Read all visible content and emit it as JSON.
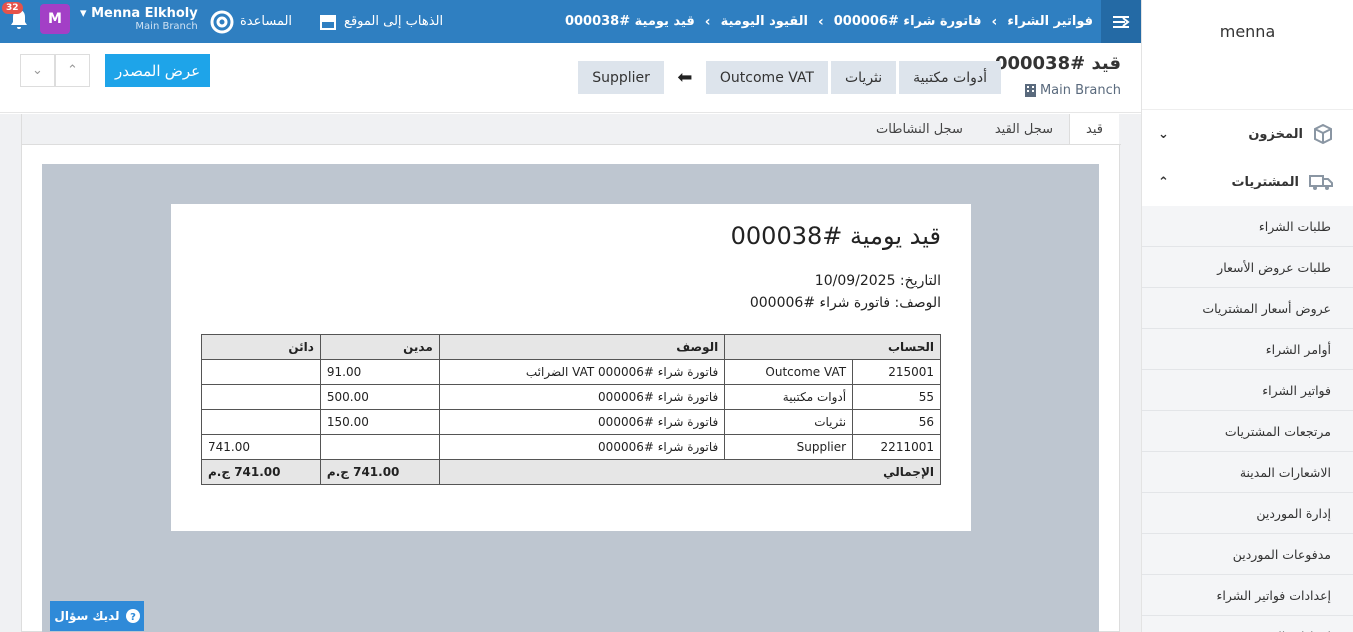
{
  "topbar": {
    "breadcrumbs": [
      "فواتير الشراء",
      "فاتورة شراء #000006",
      "القيود اليومية",
      "قيد يومية #000038"
    ],
    "goto_site": "الذهاب إلى الموقع",
    "help": "المساعدة",
    "notifications_count": "32",
    "user_name": "Menna Elkholy",
    "user_branch": "Main Branch",
    "avatar_letter": "M"
  },
  "sidebar": {
    "company": "menna",
    "sections": {
      "inventory": "المخزون",
      "purchases": "المشتريات"
    },
    "items": [
      "طلبات الشراء",
      "طلبات عروض الأسعار",
      "عروض أسعار المشتريات",
      "أوامر الشراء",
      "فواتير الشراء",
      "مرتجعات المشتريات",
      "الاشعارات المدينة",
      "إدارة الموردين",
      "مدفوعات الموردين",
      "إعدادات فواتير الشراء",
      "إعدادات الموردين"
    ]
  },
  "header": {
    "title": "قيد #000038",
    "branch": "Main Branch",
    "chips": [
      "أدوات مكتبية",
      "نثريات",
      "Outcome VAT"
    ],
    "chip_target": "Supplier",
    "view_source": "عرض المصدر"
  },
  "tabs": [
    "قيد",
    "سجل القيد",
    "سجل النشاطات"
  ],
  "document": {
    "title": "قيد يومية #000038",
    "date_line": "التاريخ: 10/09/2025",
    "desc_line": "الوصف: فاتورة شراء #000006",
    "columns": [
      "الحساب",
      "الوصف",
      "مدين",
      "دائن"
    ],
    "rows": [
      {
        "code": "215001",
        "account": "Outcome VAT",
        "desc": "فاتورة شراء #000006 VAT الضرائب",
        "debit": "91.00",
        "credit": ""
      },
      {
        "code": "55",
        "account": "أدوات مكتبية",
        "desc": "فاتورة شراء #000006",
        "debit": "500.00",
        "credit": ""
      },
      {
        "code": "56",
        "account": "نثريات",
        "desc": "فاتورة شراء #000006",
        "debit": "150.00",
        "credit": ""
      },
      {
        "code": "2211001",
        "account": "Supplier",
        "desc": "فاتورة شراء #000006",
        "debit": "",
        "credit": "741.00"
      }
    ],
    "total_label": "الإجمالي",
    "total_debit": "741.00 ج.م",
    "total_credit": "741.00 ج.م"
  },
  "help_button": "لديك سؤال"
}
